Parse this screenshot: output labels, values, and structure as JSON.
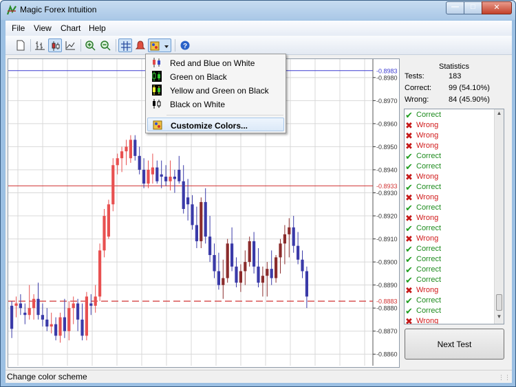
{
  "window": {
    "title": "Magic Forex Intuition"
  },
  "menu": {
    "file": "File",
    "view": "View",
    "chart": "Chart",
    "help": "Help"
  },
  "toolbar": {
    "buttons": [
      "new-document-icon",
      "bar-chart-icon",
      "candlestick-icon",
      "line-chart-icon",
      "zoom-in-icon",
      "zoom-out-icon",
      "grid-icon",
      "alert-icon",
      "color-scheme-icon",
      "help-icon"
    ]
  },
  "color_menu": {
    "items": [
      {
        "label": "Red and Blue on White",
        "icon": "red-blue-candles-icon"
      },
      {
        "label": "Green on Black",
        "icon": "green-black-candles-icon"
      },
      {
        "label": "Yellow and Green on Black",
        "icon": "yellow-green-candles-icon"
      },
      {
        "label": "Black on White",
        "icon": "black-white-candles-icon"
      }
    ],
    "customize": "Customize Colors..."
  },
  "stats": {
    "title": "Statistics",
    "tests_label": "Tests:",
    "tests_value": "183",
    "correct_label": "Correct:",
    "correct_value": "99 (54.10%)",
    "wrong_label": "Wrong:",
    "wrong_value": "84 (45.90%)"
  },
  "results": [
    "Correct",
    "Wrong",
    "Wrong",
    "Wrong",
    "Correct",
    "Correct",
    "Wrong",
    "Correct",
    "Wrong",
    "Correct",
    "Wrong",
    "Correct",
    "Wrong",
    "Correct",
    "Correct",
    "Correct",
    "Correct",
    "Wrong",
    "Correct",
    "Correct",
    "Wrong"
  ],
  "next_button": "Next Test",
  "status": "Change color scheme",
  "colors": {
    "bull": "#e85050",
    "bear": "#3a3aa8",
    "bullDark": "#8b2c2c",
    "grid": "#d8d8d8"
  },
  "chart_data": {
    "type": "candlestick",
    "y_ticks": [
      "0.8980",
      "0.8970",
      "0.8960",
      "0.8950",
      "0.8940",
      "0.8930",
      "0.8920",
      "0.8910",
      "0.8900",
      "0.8890",
      "0.8880",
      "0.8870",
      "0.8860"
    ],
    "ylim": [
      0.8855,
      0.8988
    ],
    "levels": [
      {
        "label": "0.8983",
        "value": 0.8983,
        "color": "#3b3bd1",
        "style": "solid"
      },
      {
        "label": "0.8933",
        "value": 0.8933,
        "color": "#d03030",
        "style": "solid"
      },
      {
        "label": "0.8883",
        "value": 0.8883,
        "color": "#d03030",
        "style": "dashed"
      }
    ],
    "candles": [
      [
        0.8881,
        0.8883,
        0.8867,
        0.8871
      ],
      [
        0.8881,
        0.8885,
        0.8876,
        0.8882
      ],
      [
        0.8882,
        0.8886,
        0.8877,
        0.888
      ],
      [
        0.8878,
        0.8882,
        0.8873,
        0.8877
      ],
      [
        0.8877,
        0.889,
        0.8875,
        0.888
      ],
      [
        0.888,
        0.8886,
        0.8875,
        0.8884
      ],
      [
        0.8884,
        0.8891,
        0.8875,
        0.8877
      ],
      [
        0.8877,
        0.8882,
        0.8872,
        0.8875
      ],
      [
        0.8875,
        0.888,
        0.887,
        0.8872
      ],
      [
        0.8872,
        0.8878,
        0.8869,
        0.8873
      ],
      [
        0.8873,
        0.8876,
        0.8866,
        0.8868
      ],
      [
        0.8868,
        0.8878,
        0.8865,
        0.8876
      ],
      [
        0.8876,
        0.8884,
        0.8867,
        0.887
      ],
      [
        0.887,
        0.8883,
        0.8866,
        0.888
      ],
      [
        0.888,
        0.8885,
        0.8873,
        0.8882
      ],
      [
        0.8882,
        0.8884,
        0.887,
        0.8875
      ],
      [
        0.8875,
        0.8882,
        0.8866,
        0.8868
      ],
      [
        0.8868,
        0.8887,
        0.8866,
        0.8885
      ],
      [
        0.8882,
        0.8886,
        0.8877,
        0.8881
      ],
      [
        0.8881,
        0.889,
        0.8878,
        0.8885
      ],
      [
        0.8885,
        0.8908,
        0.8883,
        0.8905
      ],
      [
        0.8905,
        0.8923,
        0.8902,
        0.892
      ],
      [
        0.8911,
        0.8927,
        0.891,
        0.8925
      ],
      [
        0.8925,
        0.8945,
        0.8922,
        0.8942
      ],
      [
        0.8942,
        0.8947,
        0.8938,
        0.8945
      ],
      [
        0.8945,
        0.895,
        0.8939,
        0.8948
      ],
      [
        0.8948,
        0.8953,
        0.8942,
        0.895
      ],
      [
        0.8945,
        0.8955,
        0.8943,
        0.8953
      ],
      [
        0.8953,
        0.8955,
        0.8944,
        0.8946
      ],
      [
        0.8946,
        0.895,
        0.8938,
        0.894
      ],
      [
        0.894,
        0.8945,
        0.8932,
        0.8934
      ],
      [
        0.8934,
        0.8944,
        0.8932,
        0.894
      ],
      [
        0.8938,
        0.8947,
        0.8934,
        0.8941
      ],
      [
        0.8941,
        0.8944,
        0.8934,
        0.8935
      ],
      [
        0.8938,
        0.8944,
        0.8932,
        0.8937
      ],
      [
        0.8937,
        0.8942,
        0.8933,
        0.8935
      ],
      [
        0.8935,
        0.8944,
        0.8931,
        0.8937
      ],
      [
        0.8937,
        0.894,
        0.893,
        0.8936
      ],
      [
        0.894,
        0.8946,
        0.8934,
        0.8935
      ],
      [
        0.8935,
        0.8942,
        0.8921,
        0.8923
      ],
      [
        0.8928,
        0.8936,
        0.8918,
        0.8925
      ],
      [
        0.8925,
        0.8929,
        0.8914,
        0.8916
      ],
      [
        0.8916,
        0.8924,
        0.8906,
        0.8909
      ],
      [
        0.8909,
        0.8928,
        0.8906,
        0.8926
      ],
      [
        0.8926,
        0.8932,
        0.8908,
        0.8911
      ],
      [
        0.8911,
        0.892,
        0.89,
        0.8903
      ],
      [
        0.8903,
        0.8908,
        0.8893,
        0.8896
      ],
      [
        0.8896,
        0.8904,
        0.8888,
        0.889
      ],
      [
        0.889,
        0.8901,
        0.8884,
        0.8893
      ],
      [
        0.8893,
        0.891,
        0.8891,
        0.8908
      ],
      [
        0.8908,
        0.8915,
        0.8896,
        0.8898
      ],
      [
        0.8898,
        0.8902,
        0.8889,
        0.8891
      ],
      [
        0.8891,
        0.8899,
        0.8887,
        0.8896
      ],
      [
        0.8896,
        0.8905,
        0.889,
        0.89
      ],
      [
        0.89,
        0.8911,
        0.8898,
        0.8909
      ],
      [
        0.8909,
        0.8913,
        0.8895,
        0.8898
      ],
      [
        0.8898,
        0.8906,
        0.8889,
        0.8891
      ],
      [
        0.8891,
        0.8898,
        0.8885,
        0.8894
      ],
      [
        0.8894,
        0.89,
        0.8885,
        0.8897
      ],
      [
        0.8897,
        0.8905,
        0.889,
        0.8893
      ],
      [
        0.8893,
        0.8903,
        0.8891,
        0.8902
      ],
      [
        0.8902,
        0.891,
        0.8895,
        0.8908
      ],
      [
        0.8908,
        0.8916,
        0.8899,
        0.8912
      ],
      [
        0.8912,
        0.8919,
        0.8902,
        0.8915
      ],
      [
        0.8915,
        0.892,
        0.8904,
        0.8907
      ],
      [
        0.8907,
        0.8913,
        0.8899,
        0.8901
      ],
      [
        0.8901,
        0.8905,
        0.8893,
        0.8896
      ],
      [
        0.8896,
        0.8898,
        0.888,
        0.8885
      ]
    ]
  }
}
